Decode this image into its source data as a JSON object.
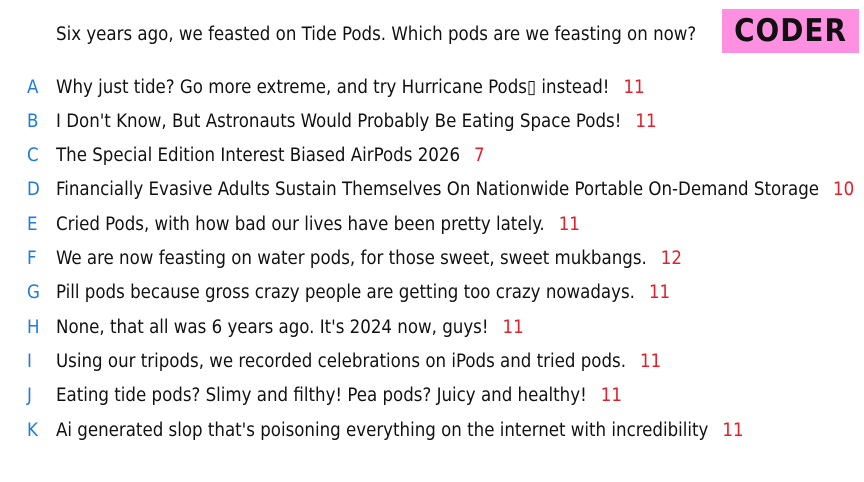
{
  "question": "Six years ago, we feasted on Tide Pods. Which pods are we feasting on now?",
  "badge": {
    "label": "CODER",
    "background": "#ff8fe0",
    "text_color": "#111111"
  },
  "colors": {
    "letter": "#1e7be0",
    "score": "#e0202a",
    "text": "#111111"
  },
  "answers": [
    {
      "letter": "A",
      "text": "Why just tide? Go more extreme, and try Hurricane Pods▯ instead!",
      "score": "11"
    },
    {
      "letter": "B",
      "text": "I Don't Know, But Astronauts Would Probably Be Eating Space Pods!",
      "score": "11"
    },
    {
      "letter": "C",
      "text": "The Special Edition Interest Biased AirPods 2026",
      "score": "7"
    },
    {
      "letter": "D",
      "text": "Financially Evasive Adults Sustain Themselves On Nationwide Portable On-Demand Storage",
      "score": "10"
    },
    {
      "letter": "E",
      "text": "Cried Pods, with how bad our lives have been pretty lately.",
      "score": "11"
    },
    {
      "letter": "F",
      "text": "We are now feasting on water pods, for those sweet, sweet mukbangs.",
      "score": "12"
    },
    {
      "letter": "G",
      "text": "Pill pods because gross crazy people are getting too crazy nowadays.",
      "score": "11"
    },
    {
      "letter": "H",
      "text": "None, that all was 6 years ago. It's 2024 now, guys!",
      "score": "11"
    },
    {
      "letter": "I",
      "text": "Using our tripods, we recorded celebrations on iPods and tried pods.",
      "score": "11"
    },
    {
      "letter": "J",
      "text": "Eating tide pods? Slimy and filthy! Pea pods? Juicy and healthy!",
      "score": "11"
    },
    {
      "letter": "K",
      "text": "Ai generated slop that's poisoning everything on the internet with incredibility",
      "score": "11"
    }
  ]
}
